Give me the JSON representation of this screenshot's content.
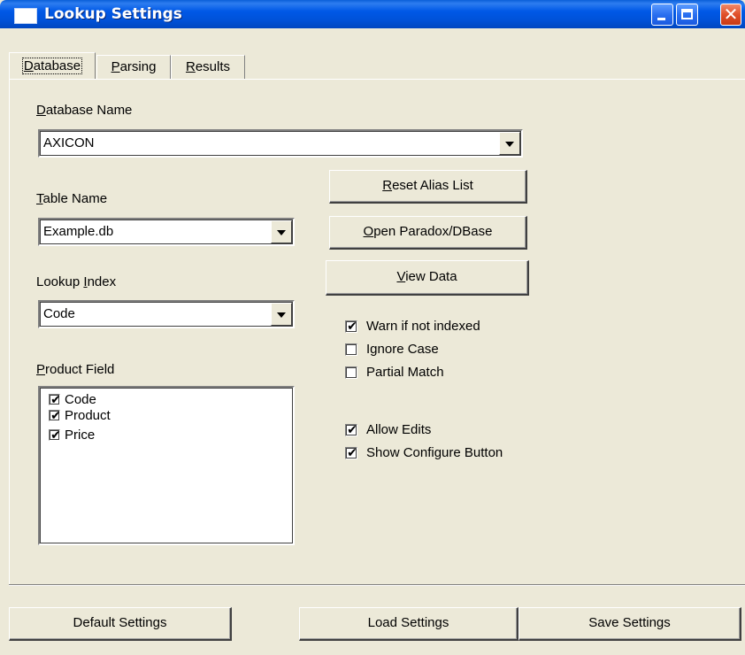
{
  "window": {
    "title": "Lookup Settings"
  },
  "tabs": [
    {
      "label": "Database",
      "accel": "D",
      "rest": "atabase",
      "active": true
    },
    {
      "label": "Parsing",
      "accel": "P",
      "rest": "arsing",
      "active": false
    },
    {
      "label": "Results",
      "accel": "R",
      "rest": "esults",
      "active": false
    }
  ],
  "database_tab": {
    "database_name": {
      "label_accel": "D",
      "label_rest": "atabase Name",
      "value": "AXICON"
    },
    "table_name": {
      "label_accel": "T",
      "label_rest": "able Name",
      "value": "Example.db"
    },
    "lookup_index": {
      "label_pre": "Lookup ",
      "label_accel": "I",
      "label_rest": "ndex",
      "value": "Code"
    },
    "product_field": {
      "label_accel": "P",
      "label_rest": "roduct Field",
      "items": [
        {
          "label": "Code",
          "checked": true
        },
        {
          "label": "Product",
          "checked": true
        },
        {
          "label": "Price",
          "checked": true
        }
      ]
    },
    "buttons": {
      "reset_alias": {
        "accel": "R",
        "rest": "eset Alias List"
      },
      "open_paradox": {
        "accel": "O",
        "rest": "pen Paradox/DBase"
      },
      "view_data": {
        "accel": "V",
        "rest": "iew Data"
      }
    },
    "options": [
      {
        "label": "Warn if not indexed",
        "checked": true
      },
      {
        "label": "Ignore Case",
        "checked": false
      },
      {
        "label": "Partial Match",
        "checked": false
      }
    ],
    "edit_options": [
      {
        "label": "Allow Edits",
        "checked": true
      },
      {
        "label": "Show Configure Button",
        "checked": true
      }
    ]
  },
  "footer": {
    "default_settings": "Default Settings",
    "load_settings": "Load Settings",
    "save_settings": "Save Settings"
  },
  "check_glyph": "✔",
  "colors": {
    "title_bar": "#0058e6",
    "window_face": "#ece9d8",
    "close_button": "#e0502a"
  }
}
